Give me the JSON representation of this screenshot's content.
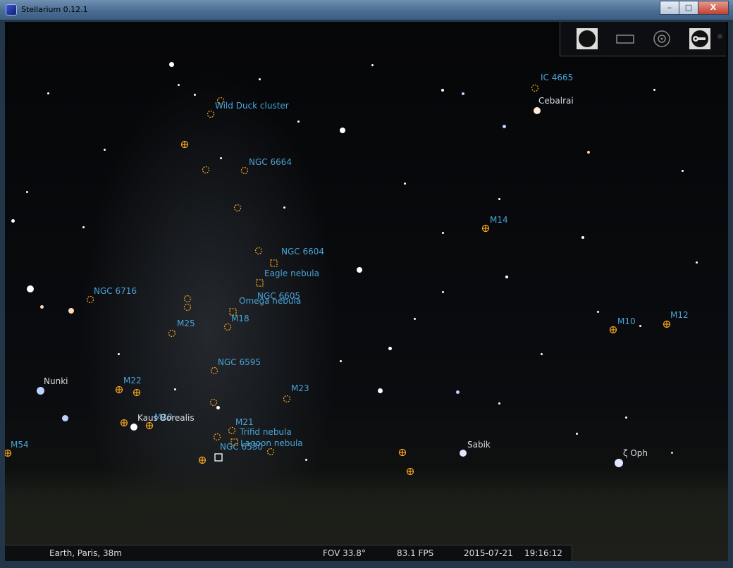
{
  "window": {
    "title": "Stellarium 0.12.1",
    "minimize": "–",
    "maximize": "□",
    "close": "X"
  },
  "status": {
    "location": "Earth, Paris, 38m",
    "fov": "FOV 33.8°",
    "fps": "83.1 FPS",
    "date": "2015-07-21",
    "time": "19:16:12"
  },
  "colors": {
    "dso_label": "#4aa3d6",
    "star_label": "#d9dde2",
    "marker": "#f0a020"
  },
  "toolbar": {
    "buttons": [
      "full-sky-icon",
      "window-mode-icon",
      "target-icon",
      "settings-icon"
    ]
  },
  "objects": {
    "ic4665": "IC 4665",
    "wild_duck": "Wild Duck cluster",
    "ngc6664": "NGC 6664",
    "m14": "M14",
    "ngc6604": "NGC 6604",
    "eagle": "Eagle nebula",
    "ngc6605": "NGC 6605",
    "omega": "Omega nebula",
    "ngc6716": "NGC 6716",
    "m18": "M18",
    "m25": "M25",
    "m10": "M10",
    "m12": "M12",
    "ngc6595": "NGC 6595",
    "m22": "M22",
    "m23": "M23",
    "m28": "M28",
    "m21": "M21",
    "trifid": "Trifid nebula",
    "lagoon": "Lagoon nebula",
    "ngc6530": "NGC 6530",
    "m54": "M54"
  },
  "stars": {
    "cebalrai": "Cebalrai",
    "nunki": "Nunki",
    "kaus_borealis": "Kaus Borealis",
    "sabik": "Sabik",
    "zeta_oph": "ζ Oph"
  }
}
